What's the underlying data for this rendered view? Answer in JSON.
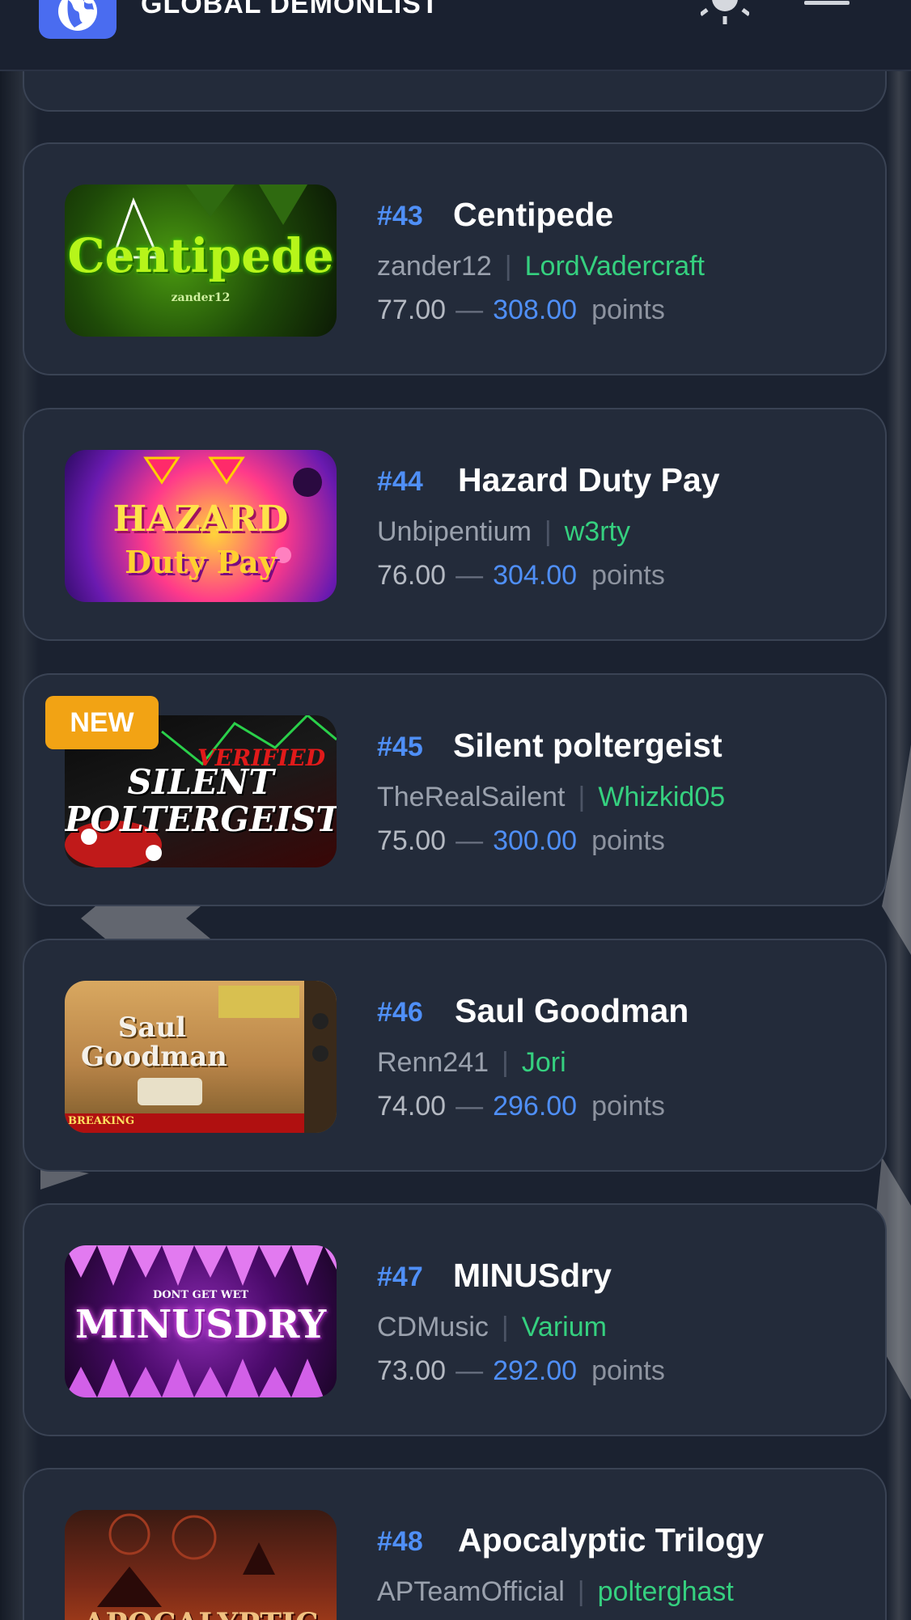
{
  "header": {
    "title": "GLOBAL DEMONLIST",
    "logo_icon": "globe-icon",
    "theme_icon": "sun-icon",
    "menu_icon": "hamburger-menu-icon"
  },
  "points_unit": "points",
  "levels": [
    {
      "rank": "#43",
      "name": "Centipede",
      "creator": "zander12",
      "verifier": "LordVadercraft",
      "points_min": "77.00",
      "points_max": "308.00",
      "thumbnail_text": "Centipede",
      "thumbnail_subtext": "zander12",
      "is_new": false
    },
    {
      "rank": "#44",
      "name": "Hazard Duty Pay",
      "creator": "Unbipentium",
      "verifier": "w3rty",
      "points_min": "76.00",
      "points_max": "304.00",
      "thumbnail_text": "HAZARD",
      "thumbnail_subtext": "Duty Pay",
      "is_new": false
    },
    {
      "rank": "#45",
      "name": "Silent poltergeist",
      "creator": "TheRealSailent",
      "verifier": "Whizkid05",
      "points_min": "75.00",
      "points_max": "300.00",
      "thumbnail_text": "SILENT POLTERGEIST",
      "thumbnail_subtext": "VERIFIED",
      "is_new": true,
      "badge": "NEW"
    },
    {
      "rank": "#46",
      "name": "Saul Goodman",
      "creator": "Renn241",
      "verifier": "Jori",
      "points_min": "74.00",
      "points_max": "296.00",
      "thumbnail_text": "Saul Goodman",
      "thumbnail_subtext": "BREAKING",
      "is_new": false
    },
    {
      "rank": "#47",
      "name": "MINUSdry",
      "creator": "CDMusic",
      "verifier": "Varium",
      "points_min": "73.00",
      "points_max": "292.00",
      "thumbnail_text": "MINUSDRY",
      "thumbnail_subtext": "DONT GET WET",
      "is_new": false
    },
    {
      "rank": "#48",
      "name": "Apocalyptic Trilogy",
      "creator": "APTeamOfficial",
      "verifier": "polterghast",
      "points_min": "",
      "points_max": "",
      "thumbnail_text": "APOCALYPTIC",
      "thumbnail_subtext": "",
      "is_new": false
    }
  ],
  "colors": {
    "accent_blue": "#4f8ff7",
    "verifier_green": "#35d07f",
    "new_badge": "#f2a314",
    "card_bg": "#232b3a"
  }
}
